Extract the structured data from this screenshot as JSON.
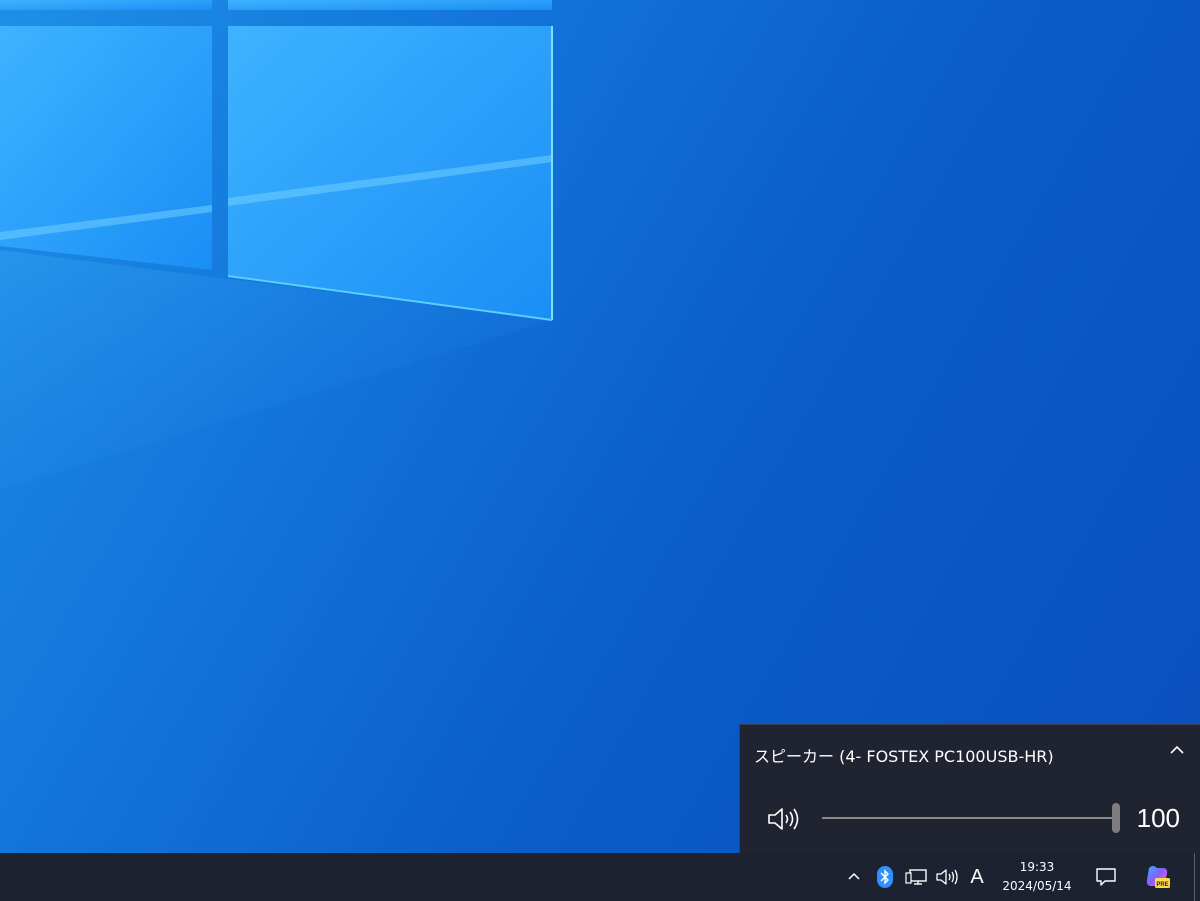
{
  "colors": {
    "wallpaper_blue": "#0b5cc8",
    "flyout_bg": "#1f2430",
    "taskbar_bg": "#1c2230",
    "slider_track": "#8b8b8b",
    "slider_thumb": "#7d7d7d",
    "bluetooth_blue": "#2f8fff"
  },
  "volume_flyout": {
    "device_name": "スピーカー (4- FOSTEX PC100USB-HR)",
    "volume_level": 100,
    "volume_display": "100",
    "icons": {
      "speaker": "speaker-volume-icon",
      "collapse": "chevron-up-icon"
    }
  },
  "taskbar": {
    "tray_icons": [
      "chevron-up-icon",
      "bluetooth-icon",
      "network-icon",
      "speaker-icon"
    ],
    "ime_mode": "A",
    "clock": {
      "time": "19:33",
      "date": "2024/05/14"
    },
    "notification_icon": "action-center-icon",
    "app_icon": "copilot-preview-icon"
  }
}
